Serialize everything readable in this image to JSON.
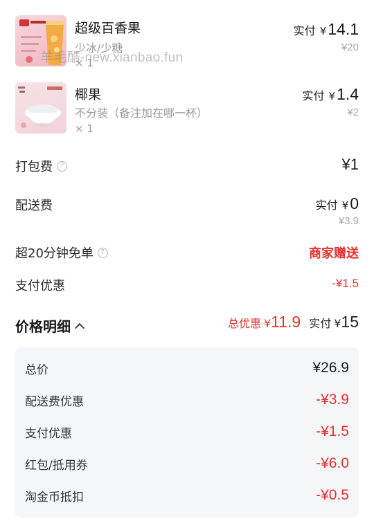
{
  "products": [
    {
      "name": "超级百香果",
      "spec": "少冰/少糖",
      "qty": "× 1",
      "paid_label": "实付",
      "paid_currency": "¥",
      "paid_value": "14.1",
      "original": "¥20",
      "thumb_icon": "passion-fruit-drink-image"
    },
    {
      "name": "椰果",
      "spec": "不分装（备注加在哪一杯）",
      "qty": "× 1",
      "paid_label": "实付",
      "paid_currency": "¥",
      "paid_value": "1.4",
      "original": "¥2",
      "thumb_icon": "coconut-jelly-bowl-image"
    }
  ],
  "watermark": "羊毛酷-new.xianbao.fun",
  "fees": {
    "packing": {
      "label": "打包费",
      "value": "¥1"
    },
    "delivery": {
      "label": "配送费",
      "paid_label": "实付",
      "currency": "¥",
      "value": "0",
      "original": "¥3.9"
    },
    "free_delivery": {
      "label": "超20分钟免单",
      "value": "商家赠送"
    },
    "payment_discount": {
      "label": "支付优惠",
      "value": "-¥1.5"
    }
  },
  "price_detail": {
    "title": "价格明细",
    "total_discount_label": "总优惠",
    "total_discount_currency": "¥",
    "total_discount_value": "11.9",
    "paid_label": "实付",
    "paid_currency": "¥",
    "paid_value": "15"
  },
  "breakdown": [
    {
      "label": "总价",
      "value": "¥26.9",
      "red": false
    },
    {
      "label": "配送费优惠",
      "value": "-¥3.9",
      "red": true
    },
    {
      "label": "支付优惠",
      "value": "-¥1.5",
      "red": true
    },
    {
      "label": "红包/抵用券",
      "value": "-¥6.0",
      "red": true
    },
    {
      "label": "淘金币抵扣",
      "value": "-¥0.5",
      "red": true
    }
  ],
  "colors": {
    "accent_red": "#e5312d",
    "card_bg": "#f5f6f8",
    "muted_gray": "#9a9a9a"
  }
}
